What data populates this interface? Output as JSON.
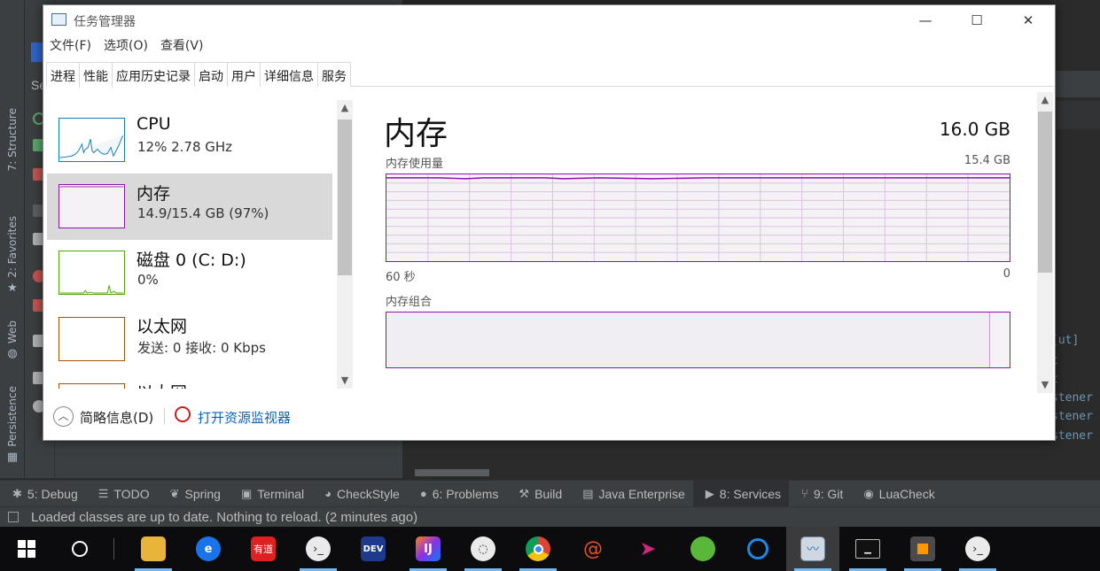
{
  "ide": {
    "left_tabs": [
      {
        "label": "7: Structure"
      },
      {
        "label": "2: Favorites"
      },
      {
        "label": "Web"
      },
      {
        "label": "Persistence"
      }
    ],
    "mid_text": "Se",
    "code_fragments": [
      "[ut]",
      "t",
      "t",
      "stener",
      "stener",
      "stener"
    ],
    "tool_windows": [
      {
        "icon": "bug-icon",
        "label": "5: Debug"
      },
      {
        "icon": "list-icon",
        "label": "TODO"
      },
      {
        "icon": "leaf-icon",
        "label": "Spring"
      },
      {
        "icon": "terminal-icon",
        "label": "Terminal"
      },
      {
        "icon": "checkstyle-icon",
        "label": "CheckStyle"
      },
      {
        "icon": "problems-icon",
        "label": "6: Problems"
      },
      {
        "icon": "hammer-icon",
        "label": "Build"
      },
      {
        "icon": "enterprise-icon",
        "label": "Java Enterprise"
      },
      {
        "icon": "services-icon",
        "label": "8: Services"
      },
      {
        "icon": "git-icon",
        "label": "9: Git"
      },
      {
        "icon": "lua-icon",
        "label": "LuaCheck"
      }
    ],
    "status_text": "Loaded classes are up to date. Nothing to reload. (2 minutes ago)"
  },
  "taskmanager": {
    "title": "任务管理器",
    "menu": [
      "文件(F)",
      "选项(O)",
      "查看(V)"
    ],
    "tabs": [
      "进程",
      "性能",
      "应用历史记录",
      "启动",
      "用户",
      "详细信息",
      "服务"
    ],
    "selected_tab": "性能",
    "perf_items": [
      {
        "name": "CPU",
        "sub": "12%  2.78 GHz",
        "color": "#117dbb"
      },
      {
        "name": "内存",
        "sub": "14.9/15.4 GB (97%)",
        "color": "#8b12ae"
      },
      {
        "name": "磁盘 0 (C: D:)",
        "sub": "0%",
        "color": "#4da60c"
      },
      {
        "name": "以太网",
        "sub": "发送: 0  接收: 0 Kbps",
        "color": "#a74f01"
      },
      {
        "name": "以太网",
        "sub": "",
        "color": "#a74f01"
      }
    ],
    "detail": {
      "title": "内存",
      "total": "16.0 GB",
      "usage_label": "内存使用量",
      "usage_max": "15.4 GB",
      "x_left": "60 秒",
      "x_right": "0",
      "composition_label": "内存组合",
      "usage_percent": 97
    },
    "footer": {
      "fewer_details": "简略信息(D)",
      "open_resmon": "打开资源监视器"
    }
  },
  "taskbar": {
    "apps": [
      {
        "icon": "start-icon"
      },
      {
        "icon": "cortana-icon"
      },
      {
        "icon": "explorer-icon"
      },
      {
        "icon": "edge-icon"
      },
      {
        "icon": "youdao-icon",
        "label": "有道"
      },
      {
        "icon": "wechat-dev-icon"
      },
      {
        "icon": "devecostudio-icon",
        "label": "DEV"
      },
      {
        "icon": "intellij-icon",
        "label": "IJ"
      },
      {
        "icon": "wechat-icon"
      },
      {
        "icon": "chrome-icon"
      },
      {
        "icon": "snail-icon"
      },
      {
        "icon": "paper-plane-icon"
      },
      {
        "icon": "frog-icon"
      },
      {
        "icon": "search-q-icon"
      },
      {
        "icon": "taskmanager-icon"
      },
      {
        "icon": "cmd-icon"
      },
      {
        "icon": "sublime-icon"
      },
      {
        "icon": "wechat-dev2-icon"
      }
    ]
  }
}
